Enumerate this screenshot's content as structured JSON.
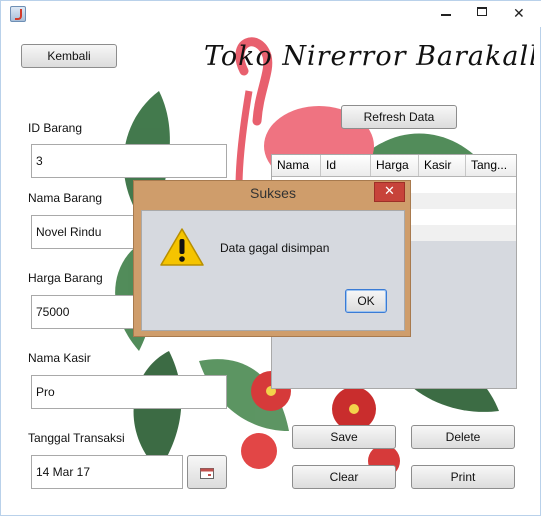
{
  "window": {
    "minimize_glyph": "—",
    "maximize_glyph": "□",
    "close_glyph": "✕"
  },
  "header": {
    "back_label": "Kembali",
    "store_title": "Toko Nirerror Barakallah",
    "refresh_label": "Refresh Data"
  },
  "form": {
    "id_label": "ID Barang",
    "id_value": "3",
    "name_label": "Nama Barang",
    "name_value": "Novel Rindu",
    "price_label": "Harga Barang",
    "price_value": "75000",
    "cashier_label": "Nama Kasir",
    "cashier_value": "Pro",
    "date_label": "Tanggal Transaksi",
    "date_value": "14 Mar 17"
  },
  "table": {
    "columns": [
      "Nama",
      "Id",
      "Harga",
      "Kasir",
      "Tang..."
    ],
    "rows": [
      [
        "",
        "",
        "",
        "",
        ""
      ],
      [
        "",
        "",
        "",
        "",
        ""
      ],
      [
        "",
        "",
        "",
        "",
        ""
      ],
      [
        "",
        "",
        "",
        "",
        ""
      ]
    ]
  },
  "actions": {
    "save_label": "Save",
    "delete_label": "Delete",
    "clear_label": "Clear",
    "print_label": "Print"
  },
  "dialog": {
    "title": "Sukses",
    "message": "Data gagal disimpan",
    "ok_label": "OK",
    "close_glyph": "✕"
  },
  "colors": {
    "dialog_frame": "#cf9d6b",
    "dialog_close": "#c7433a",
    "warning_yellow": "#f5c400",
    "flamingo": "#e8606e",
    "leaf_green": "#2f6b3a"
  },
  "icons": {
    "app": "java-app-icon",
    "warning": "warning-triangle-icon",
    "calendar": "calendar-icon"
  }
}
